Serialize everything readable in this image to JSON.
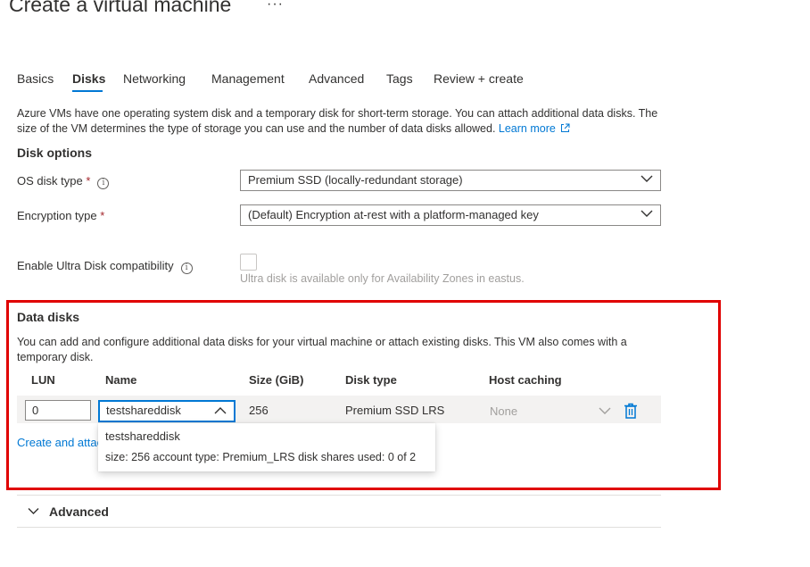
{
  "page": {
    "title": "Create a virtual machine",
    "more_label": "···"
  },
  "tabs": [
    {
      "label": "Basics"
    },
    {
      "label": "Disks"
    },
    {
      "label": "Networking"
    },
    {
      "label": "Management"
    },
    {
      "label": "Advanced"
    },
    {
      "label": "Tags"
    },
    {
      "label": "Review + create"
    }
  ],
  "intro": {
    "text": "Azure VMs have one operating system disk and a temporary disk for short-term storage. You can attach additional data disks. The size of the VM determines the type of storage you can use and the number of data disks allowed.",
    "learn_more": "Learn more"
  },
  "disk_options": {
    "title": "Disk options",
    "os_disk_type": {
      "label": "OS disk type",
      "required": "*",
      "value": "Premium SSD (locally-redundant storage)"
    },
    "encryption_type": {
      "label": "Encryption type",
      "required": "*",
      "value": "(Default) Encryption at-rest with a platform-managed key"
    },
    "ultra_disk": {
      "label": "Enable Ultra Disk compatibility",
      "hint": "Ultra disk is available only for Availability Zones in eastus."
    }
  },
  "data_disks": {
    "title": "Data disks",
    "description": "You can add and configure additional data disks for your virtual machine or attach existing disks. This VM also comes with a temporary disk.",
    "columns": [
      "LUN",
      "Name",
      "Size (GiB)",
      "Disk type",
      "Host caching"
    ],
    "row": {
      "lun": "0",
      "name": "testshareddisk",
      "size": "256",
      "disk_type": "Premium SSD LRS",
      "host_caching": "None"
    },
    "create_link": "Create and attac",
    "dropdown": {
      "option_title": "testshareddisk",
      "option_detail": "size: 256 account type: Premium_LRS disk shares used: 0 of 2"
    }
  },
  "advanced_section": {
    "label": "Advanced"
  },
  "colors": {
    "accent": "#0078d4",
    "highlight_box": "#e00000",
    "required": "#a4262c"
  },
  "icons": [
    "info-icon",
    "chevron-down-icon",
    "chevron-up-icon",
    "external-link-icon",
    "trash-icon"
  ]
}
